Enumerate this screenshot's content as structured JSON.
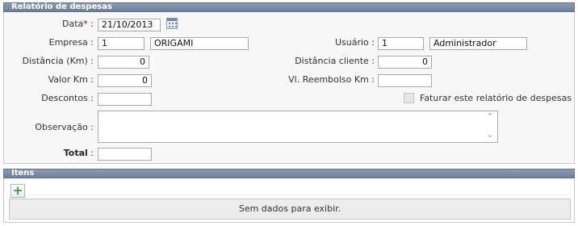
{
  "report": {
    "title": "Relatório de despesas",
    "date_label": "Data",
    "required_mark": "*",
    "date_value": "21/10/2013",
    "empresa_label": "Empresa :",
    "empresa_code": "1",
    "empresa_name": "ORIGAMI",
    "usuario_label": "Usuário :",
    "usuario_code": "1",
    "usuario_name": "Administrador",
    "distancia_label": "Distância (Km) :",
    "distancia_value": "0",
    "distancia_cliente_label": "Distância cliente :",
    "distancia_cliente_value": "0",
    "valor_km_label": "Valor Km :",
    "valor_km_value": "0",
    "reembolso_label": "Vl. Reembolso Km :",
    "reembolso_value": "",
    "descontos_label": "Descontos :",
    "descontos_value": "",
    "faturar_label": "Faturar este relatório de despesas",
    "faturar_checked": false,
    "observacao_label": "Observação :",
    "observacao_value": "",
    "total_label": "Total",
    "total_value": ""
  },
  "items": {
    "title": "Ítens",
    "add_icon": "plus-icon",
    "empty_message": "Sem dados para exibir."
  },
  "colors": {
    "header_bg": "#7a8aa3",
    "panel_bg": "#f7f7f7",
    "required": "#cc0000",
    "add_green": "#2ea12e"
  }
}
